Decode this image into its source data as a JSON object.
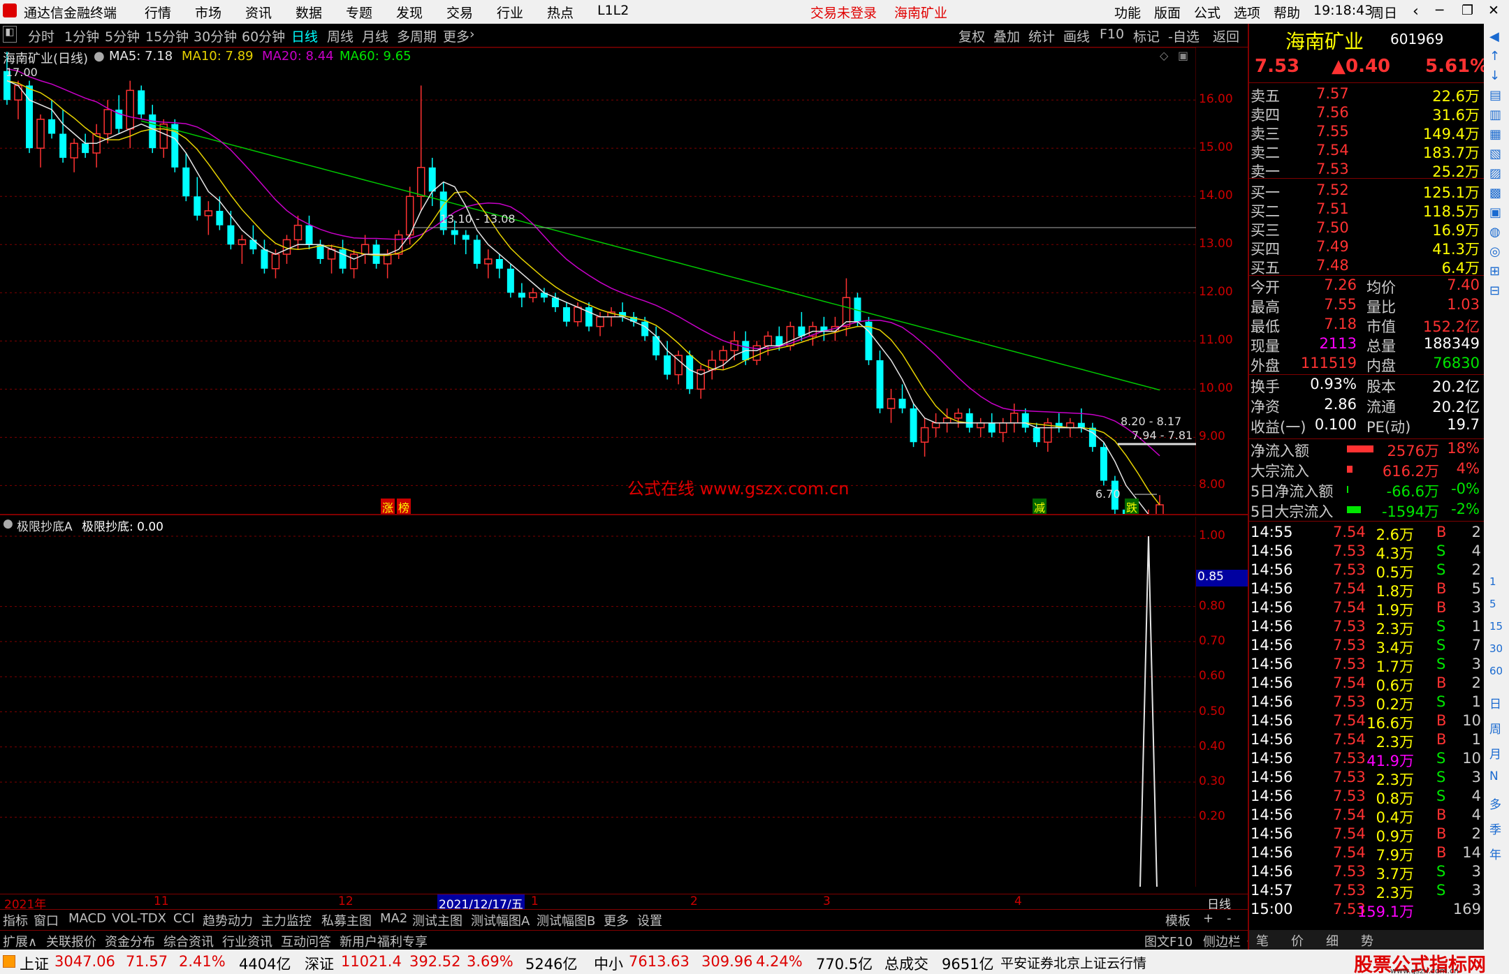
{
  "app": {
    "title": "通达信金融终端",
    "menu": [
      "行情",
      "市场",
      "资讯",
      "数据",
      "专题",
      "发现",
      "交易",
      "行业",
      "热点",
      "L1L2"
    ],
    "status_login": "交易未登录",
    "stock_title": "海南矿业",
    "right_menu": [
      "功能",
      "版面",
      "公式",
      "选项",
      "帮助"
    ],
    "clock": "19:18:43",
    "weekday": "周日"
  },
  "toolbar": {
    "periods": [
      "分时",
      "1分钟",
      "5分钟",
      "15分钟",
      "30分钟",
      "60分钟",
      "日线",
      "周线",
      "月线",
      "多周期",
      "更多"
    ],
    "active_index": 6,
    "tools": [
      "复权",
      "叠加",
      "统计",
      "画线",
      "F10",
      "标记",
      "-自选",
      "返回"
    ]
  },
  "chart_header": {
    "name": "海南矿业(日线)",
    "ma5": "MA5: 7.18",
    "ma10": "MA10: 7.89",
    "ma20": "MA20: 8.44",
    "ma60": "MA60: 9.65"
  },
  "chart_data": {
    "type": "candlestick",
    "y_axis": [
      "16.00",
      "15.00",
      "14.00",
      "13.00",
      "12.00",
      "11.00",
      "10.00",
      "9.00",
      "8.00"
    ],
    "y_range": [
      7.6,
      16.8
    ],
    "candles": [
      [
        16.6,
        17.0,
        15.9,
        16.0
      ],
      [
        16.0,
        16.4,
        15.6,
        16.3
      ],
      [
        16.3,
        16.4,
        14.9,
        15.0
      ],
      [
        15.0,
        15.7,
        14.6,
        15.6
      ],
      [
        15.6,
        16.0,
        15.2,
        15.3
      ],
      [
        15.3,
        15.8,
        14.7,
        14.8
      ],
      [
        14.8,
        15.2,
        14.5,
        15.1
      ],
      [
        15.1,
        15.3,
        14.8,
        14.9
      ],
      [
        14.9,
        15.5,
        14.6,
        15.3
      ],
      [
        15.3,
        16.0,
        15.1,
        15.8
      ],
      [
        15.8,
        16.1,
        15.3,
        15.4
      ],
      [
        15.4,
        16.4,
        15.0,
        16.2
      ],
      [
        16.2,
        16.3,
        15.6,
        15.7
      ],
      [
        15.7,
        15.9,
        14.9,
        15.0
      ],
      [
        15.0,
        15.6,
        14.8,
        15.5
      ],
      [
        15.5,
        15.6,
        14.5,
        14.6
      ],
      [
        14.6,
        14.9,
        13.9,
        14.0
      ],
      [
        14.0,
        14.4,
        13.5,
        13.6
      ],
      [
        13.6,
        13.9,
        13.2,
        13.7
      ],
      [
        13.7,
        14.0,
        13.3,
        13.4
      ],
      [
        13.4,
        13.7,
        12.9,
        13.0
      ],
      [
        13.0,
        13.2,
        12.6,
        13.1
      ],
      [
        13.1,
        13.4,
        12.8,
        12.9
      ],
      [
        12.9,
        13.1,
        12.4,
        12.5
      ],
      [
        12.5,
        12.9,
        12.3,
        12.8
      ],
      [
        12.8,
        13.2,
        12.6,
        13.1
      ],
      [
        13.1,
        13.6,
        12.9,
        13.4
      ],
      [
        13.4,
        13.6,
        12.9,
        13.0
      ],
      [
        13.0,
        13.1,
        12.6,
        12.7
      ],
      [
        12.7,
        13.0,
        12.4,
        12.9
      ],
      [
        12.9,
        13.1,
        12.4,
        12.5
      ],
      [
        12.5,
        12.9,
        12.3,
        12.8
      ],
      [
        12.8,
        13.2,
        12.6,
        13.0
      ],
      [
        13.0,
        13.1,
        12.5,
        12.6
      ],
      [
        12.6,
        12.9,
        12.3,
        12.8
      ],
      [
        12.8,
        13.3,
        12.7,
        13.2
      ],
      [
        13.2,
        14.2,
        13.0,
        14.0
      ],
      [
        14.0,
        16.3,
        13.7,
        14.6
      ],
      [
        14.6,
        14.8,
        13.8,
        14.1
      ],
      [
        14.1,
        14.3,
        13.2,
        13.3
      ],
      [
        13.3,
        13.5,
        13.0,
        13.2
      ],
      [
        13.2,
        13.3,
        12.8,
        13.1
      ],
      [
        13.1,
        13.2,
        12.5,
        12.6
      ],
      [
        12.6,
        12.9,
        12.3,
        12.7
      ],
      [
        12.7,
        12.8,
        12.3,
        12.5
      ],
      [
        12.5,
        12.6,
        11.9,
        12.0
      ],
      [
        12.0,
        12.2,
        11.7,
        11.9
      ],
      [
        11.9,
        12.1,
        11.8,
        12.0
      ],
      [
        12.0,
        12.1,
        11.8,
        11.9
      ],
      [
        11.9,
        12.0,
        11.6,
        11.7
      ],
      [
        11.7,
        11.8,
        11.3,
        11.4
      ],
      [
        11.4,
        11.8,
        11.3,
        11.7
      ],
      [
        11.7,
        11.8,
        11.2,
        11.3
      ],
      [
        11.3,
        11.6,
        11.1,
        11.5
      ],
      [
        11.5,
        11.7,
        11.3,
        11.6
      ],
      [
        11.6,
        11.8,
        11.4,
        11.5
      ],
      [
        11.5,
        11.6,
        11.3,
        11.4
      ],
      [
        11.4,
        11.5,
        11.0,
        11.1
      ],
      [
        11.1,
        11.3,
        10.6,
        10.7
      ],
      [
        10.7,
        11.0,
        10.2,
        10.3
      ],
      [
        10.3,
        10.8,
        10.1,
        10.7
      ],
      [
        10.7,
        10.8,
        9.9,
        10.0
      ],
      [
        10.0,
        10.5,
        9.8,
        10.4
      ],
      [
        10.4,
        10.8,
        10.2,
        10.6
      ],
      [
        10.6,
        10.9,
        10.4,
        10.8
      ],
      [
        10.8,
        11.2,
        10.6,
        11.0
      ],
      [
        11.0,
        11.2,
        10.5,
        10.6
      ],
      [
        10.6,
        11.0,
        10.5,
        10.9
      ],
      [
        10.9,
        11.2,
        10.7,
        11.1
      ],
      [
        11.1,
        11.3,
        10.8,
        10.9
      ],
      [
        10.9,
        11.4,
        10.8,
        11.3
      ],
      [
        11.3,
        11.6,
        11.0,
        11.1
      ],
      [
        11.1,
        11.4,
        10.9,
        11.3
      ],
      [
        11.3,
        11.5,
        11.0,
        11.2
      ],
      [
        11.2,
        11.5,
        11.0,
        11.3
      ],
      [
        11.3,
        12.3,
        11.1,
        11.9
      ],
      [
        11.9,
        12.0,
        11.3,
        11.4
      ],
      [
        11.4,
        11.5,
        10.5,
        10.6
      ],
      [
        10.6,
        10.8,
        9.5,
        9.6
      ],
      [
        9.6,
        10.0,
        9.3,
        9.8
      ],
      [
        9.8,
        10.1,
        9.5,
        9.6
      ],
      [
        9.6,
        9.7,
        8.8,
        8.9
      ],
      [
        8.9,
        9.4,
        8.6,
        9.2
      ],
      [
        9.2,
        9.5,
        9.0,
        9.3
      ],
      [
        9.3,
        9.6,
        9.1,
        9.4
      ],
      [
        9.4,
        9.6,
        9.2,
        9.5
      ],
      [
        9.5,
        9.6,
        9.1,
        9.2
      ],
      [
        9.2,
        9.4,
        9.0,
        9.3
      ],
      [
        9.3,
        9.5,
        9.0,
        9.1
      ],
      [
        9.1,
        9.4,
        8.9,
        9.3
      ],
      [
        9.3,
        9.7,
        9.1,
        9.5
      ],
      [
        9.5,
        9.6,
        9.1,
        9.2
      ],
      [
        9.2,
        9.3,
        8.8,
        8.9
      ],
      [
        8.9,
        9.4,
        8.7,
        9.3
      ],
      [
        9.3,
        9.5,
        9.1,
        9.2
      ],
      [
        9.2,
        9.4,
        9.0,
        9.3
      ],
      [
        9.3,
        9.6,
        9.1,
        9.2
      ],
      [
        9.2,
        9.3,
        8.7,
        8.8
      ],
      [
        8.8,
        8.9,
        8.0,
        8.1
      ],
      [
        8.1,
        8.2,
        7.4,
        7.5
      ],
      [
        7.5,
        7.6,
        6.9,
        7.1
      ],
      [
        7.1,
        7.5,
        7.0,
        7.3
      ],
      [
        7.3,
        7.5,
        7.2,
        7.4
      ],
      [
        7.4,
        7.8,
        7.3,
        7.6
      ]
    ],
    "ma5": [
      16.4,
      16.3,
      16.0,
      15.9,
      15.8,
      15.5,
      15.3,
      15.1,
      15.1,
      15.2,
      15.3,
      15.4,
      15.5,
      15.4,
      15.3,
      15.2,
      14.9,
      14.5,
      14.1,
      13.9,
      13.6,
      13.3,
      13.1,
      12.9,
      12.8,
      12.9,
      13.0,
      13.0,
      13.0,
      12.9,
      12.8,
      12.7,
      12.8,
      12.8,
      12.8,
      12.9,
      13.2,
      13.7,
      14.1,
      14.3,
      14.2,
      13.8,
      13.3,
      13.0,
      12.8,
      12.6,
      12.4,
      12.2,
      12.0,
      11.9,
      11.8,
      11.7,
      11.6,
      11.5,
      11.5,
      11.5,
      11.4,
      11.3,
      11.1,
      10.8,
      10.6,
      10.4,
      10.3,
      10.4,
      10.5,
      10.7,
      10.8,
      10.8,
      10.9,
      10.9,
      11.0,
      11.1,
      11.2,
      11.2,
      11.2,
      11.4,
      11.4,
      11.2,
      10.9,
      10.6,
      10.2,
      9.7,
      9.4,
      9.3,
      9.3,
      9.3,
      9.3,
      9.3,
      9.3,
      9.3,
      9.3,
      9.3,
      9.2,
      9.2,
      9.2,
      9.2,
      9.2,
      9.1,
      8.9,
      8.5,
      8.0,
      7.7,
      7.4,
      7.3
    ]
  },
  "price_labels": {
    "top": "17.00",
    "range1": "13.10 - 13.08",
    "range2": "8.20 - 8.17",
    "range3": "7.94 - 7.81",
    "low": "6.70"
  },
  "watermark": "公式在线  www.gszx.com.cn",
  "markers": {
    "zhang": "涨",
    "bang": "榜",
    "jian": "减",
    "die": "跌"
  },
  "sub": {
    "title": "极限抄底A",
    "value_label": "极限抄底: 0.00",
    "axis": [
      "1.00",
      "0.80",
      "0.70",
      "0.60",
      "0.50",
      "0.40",
      "0.30",
      "0.20"
    ],
    "box": "0.85"
  },
  "dates": {
    "year": "2021年",
    "m11": "11",
    "m12": "12",
    "sel": "2021/12/17/五",
    "m1": "1",
    "m2": "2",
    "m3": "3",
    "m4": "4",
    "period": "日线"
  },
  "bottom_tabs": [
    "指标",
    "窗口",
    "MACD",
    "VOL-TDX",
    "CCI",
    "趋势动力",
    "主力监控",
    "私募主图",
    "MA2",
    "测试主图",
    "测试幅图A",
    "测试幅图B",
    "更多",
    "设置"
  ],
  "bottom_right": [
    "模板",
    "+",
    "-"
  ],
  "info_tabs": [
    "扩展∧",
    "关联报价",
    "资金分布",
    "综合资讯",
    "行业资讯",
    "互动问答",
    "新用户福利专享"
  ],
  "info_right": [
    "图文F10",
    "侧边栏《"
  ],
  "quote": {
    "name": "海南矿业",
    "code": "601969",
    "price": "7.53",
    "change": "▲0.40",
    "pct": "5.61%",
    "asks": [
      [
        "卖五",
        "7.57",
        "22.6万"
      ],
      [
        "卖四",
        "7.56",
        "31.6万"
      ],
      [
        "卖三",
        "7.55",
        "149.4万"
      ],
      [
        "卖二",
        "7.54",
        "183.7万"
      ],
      [
        "卖一",
        "7.53",
        "25.2万"
      ]
    ],
    "bids": [
      [
        "买一",
        "7.52",
        "125.1万"
      ],
      [
        "买二",
        "7.51",
        "118.5万"
      ],
      [
        "买三",
        "7.50",
        "16.9万"
      ],
      [
        "买四",
        "7.49",
        "41.3万"
      ],
      [
        "买五",
        "7.48",
        "6.4万"
      ]
    ],
    "stats": [
      [
        "今开",
        "7.26",
        "均价",
        "7.40"
      ],
      [
        "最高",
        "7.55",
        "量比",
        "1.03"
      ],
      [
        "最低",
        "7.18",
        "市值",
        "152.2亿"
      ],
      [
        "现量",
        "2113",
        "总量",
        "188349"
      ],
      [
        "外盘",
        "111519",
        "内盘",
        "76830"
      ]
    ],
    "stats2": [
      [
        "换手",
        "0.93%",
        "股本",
        "20.2亿"
      ],
      [
        "净资",
        "2.86",
        "流通",
        "20.2亿"
      ],
      [
        "收益(一)",
        "0.100",
        "PE(动)",
        "19.7"
      ]
    ],
    "flows": [
      [
        "净流入额",
        "2576万",
        "18%"
      ],
      [
        "大宗流入",
        "616.2万",
        "4%"
      ],
      [
        "5日净流入额",
        "-66.6万",
        "-0%"
      ],
      [
        "5日大宗流入",
        "-1594万",
        "-2%"
      ]
    ]
  },
  "ticks": [
    [
      "14:55",
      "7.54",
      "2.6万",
      "B",
      "2"
    ],
    [
      "14:56",
      "7.53",
      "4.3万",
      "S",
      "4"
    ],
    [
      "14:56",
      "7.53",
      "0.5万",
      "S",
      "2"
    ],
    [
      "14:56",
      "7.54",
      "1.8万",
      "B",
      "5"
    ],
    [
      "14:56",
      "7.54",
      "1.9万",
      "B",
      "3"
    ],
    [
      "14:56",
      "7.53",
      "2.3万",
      "S",
      "1"
    ],
    [
      "14:56",
      "7.53",
      "3.4万",
      "S",
      "7"
    ],
    [
      "14:56",
      "7.53",
      "1.7万",
      "S",
      "3"
    ],
    [
      "14:56",
      "7.54",
      "0.6万",
      "B",
      "2"
    ],
    [
      "14:56",
      "7.53",
      "0.2万",
      "S",
      "1"
    ],
    [
      "14:56",
      "7.54",
      "16.6万",
      "B",
      "10"
    ],
    [
      "14:56",
      "7.54",
      "2.3万",
      "B",
      "1"
    ],
    [
      "14:56",
      "7.53",
      "41.9万",
      "S",
      "10"
    ],
    [
      "14:56",
      "7.53",
      "2.3万",
      "S",
      "3"
    ],
    [
      "14:56",
      "7.53",
      "0.8万",
      "S",
      "4"
    ],
    [
      "14:56",
      "7.54",
      "0.4万",
      "B",
      "4"
    ],
    [
      "14:56",
      "7.54",
      "0.9万",
      "B",
      "2"
    ],
    [
      "14:56",
      "7.54",
      "7.9万",
      "B",
      "14"
    ],
    [
      "14:56",
      "7.53",
      "3.7万",
      "S",
      "3"
    ],
    [
      "14:57",
      "7.53",
      "2.3万",
      "S",
      "3"
    ],
    [
      "15:00",
      "7.53",
      "159.1万",
      "",
      "169"
    ]
  ],
  "side_icons": [
    "日",
    "周",
    "月",
    "N",
    "多",
    "季",
    "年"
  ],
  "side_nums": [
    "1",
    "5",
    "15",
    "30",
    "60"
  ],
  "status": {
    "sh_label": "上证",
    "sh_val": "3047.06",
    "sh_chg": "71.57",
    "sh_pct": "2.41%",
    "sh_amt": "4404亿",
    "sz_label": "深证",
    "sz_val": "11021.4",
    "sz_chg": "392.52",
    "sz_pct": "3.69%",
    "sz_amt": "5246亿",
    "zx_label": "中小",
    "zx_val": "7613.63",
    "zx_chg": "309.96",
    "zx_pct": "4.24%",
    "zx_amt": "770.5亿",
    "total_label": "总成交",
    "total_val": "9651亿",
    "broker": "平安证券北京上证云行情",
    "brand": "股票公式指标网",
    "brand_url": "www.gszx.com.cn"
  },
  "rp_tabs": [
    "笔",
    "价",
    "细",
    "势"
  ]
}
